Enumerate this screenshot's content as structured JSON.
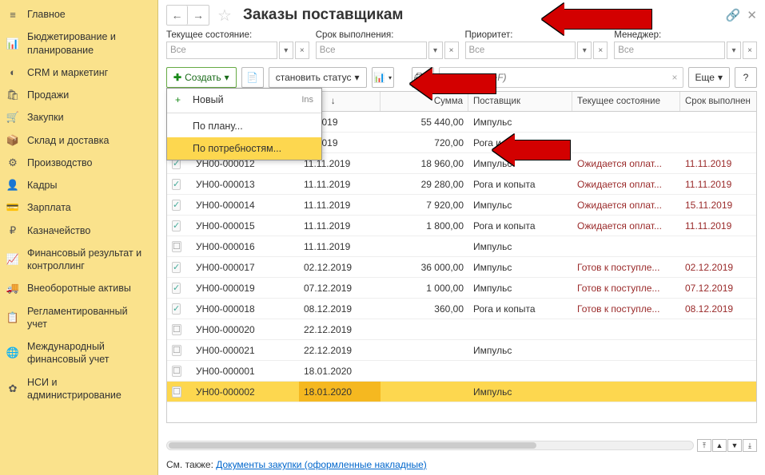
{
  "sidebar": {
    "items": [
      {
        "icon": "≡",
        "label": "Главное"
      },
      {
        "icon": "📊",
        "label": "Бюджетирование и планирование"
      },
      {
        "icon": "◐",
        "label": "CRM и маркетинг"
      },
      {
        "icon": "🛍",
        "label": "Продажи"
      },
      {
        "icon": "🛒",
        "label": "Закупки"
      },
      {
        "icon": "📦",
        "label": "Склад и доставка"
      },
      {
        "icon": "⚙",
        "label": "Производство"
      },
      {
        "icon": "👤",
        "label": "Кадры"
      },
      {
        "icon": "💳",
        "label": "Зарплата"
      },
      {
        "icon": "₽",
        "label": "Казначейство"
      },
      {
        "icon": "📈",
        "label": "Финансовый результат и контроллинг"
      },
      {
        "icon": "🚚",
        "label": "Внеоборотные активы"
      },
      {
        "icon": "📋",
        "label": "Регламентированный учет"
      },
      {
        "icon": "🌐",
        "label": "Международный финансовый учет"
      },
      {
        "icon": "✿",
        "label": "НСИ и администрирование"
      }
    ]
  },
  "header": {
    "title": "Заказы поставщикам"
  },
  "filters": {
    "f1": {
      "label": "Текущее состояние:",
      "value": "Все"
    },
    "f2": {
      "label": "Срок выполнения:",
      "value": "Все"
    },
    "f3": {
      "label": "Приоритет:",
      "value": "Все"
    },
    "f4": {
      "label": "Менеджер:",
      "value": "Все"
    }
  },
  "toolbar": {
    "create": "Создать",
    "set_status": "становить статус",
    "search_ph": "Поиск (Ctrl+F)",
    "more": "Еще",
    "help": "?"
  },
  "dropdown": {
    "items": [
      {
        "icon": "+",
        "label": "Новый",
        "shortcut": "Ins"
      },
      {
        "icon": "",
        "label": "По плану...",
        "shortcut": ""
      },
      {
        "icon": "",
        "label": "По потребностям...",
        "shortcut": "",
        "hl": true
      }
    ]
  },
  "table": {
    "headers": {
      "date": "та",
      "sum": "Сумма",
      "supplier": "Поставщик",
      "status": "Текущее состояние",
      "deadline": "Срок выполнен"
    },
    "rows": [
      {
        "icon": "✓",
        "no": "",
        "date": "11.2019",
        "sum": "55 440,00",
        "supplier": "Импульс",
        "status": "",
        "deadline": ""
      },
      {
        "icon": "✓",
        "no": "",
        "date": "11.2019",
        "sum": "720,00",
        "supplier": "Рога и копыта",
        "status": "",
        "deadline": ""
      },
      {
        "icon": "✓",
        "no": "УН00-000012",
        "date": "11.11.2019",
        "sum": "18 960,00",
        "supplier": "Импульс",
        "status": "Ожидается оплат...",
        "deadline": "11.11.2019"
      },
      {
        "icon": "✓",
        "no": "УН00-000013",
        "date": "11.11.2019",
        "sum": "29 280,00",
        "supplier": "Рога и копыта",
        "status": "Ожидается оплат...",
        "deadline": "11.11.2019"
      },
      {
        "icon": "✓",
        "no": "УН00-000014",
        "date": "11.11.2019",
        "sum": "7 920,00",
        "supplier": "Импульс",
        "status": "Ожидается оплат...",
        "deadline": "15.11.2019"
      },
      {
        "icon": "✓",
        "no": "УН00-000015",
        "date": "11.11.2019",
        "sum": "1 800,00",
        "supplier": "Рога и копыта",
        "status": "Ожидается оплат...",
        "deadline": "11.11.2019"
      },
      {
        "icon": "",
        "no": "УН00-000016",
        "date": "11.11.2019",
        "sum": "",
        "supplier": "Импульс",
        "status": "",
        "deadline": ""
      },
      {
        "icon": "✓",
        "no": "УН00-000017",
        "date": "02.12.2019",
        "sum": "36 000,00",
        "supplier": "Импульс",
        "status": "Готов к поступле...",
        "deadline": "02.12.2019"
      },
      {
        "icon": "✓",
        "no": "УН00-000019",
        "date": "07.12.2019",
        "sum": "1 000,00",
        "supplier": "Импульс",
        "status": "Готов к поступле...",
        "deadline": "07.12.2019"
      },
      {
        "icon": "✓",
        "no": "УН00-000018",
        "date": "08.12.2019",
        "sum": "360,00",
        "supplier": "Рога и копыта",
        "status": "Готов к поступле...",
        "deadline": "08.12.2019"
      },
      {
        "icon": "",
        "no": "УН00-000020",
        "date": "22.12.2019",
        "sum": "",
        "supplier": "",
        "status": "",
        "deadline": ""
      },
      {
        "icon": "",
        "no": "УН00-000021",
        "date": "22.12.2019",
        "sum": "",
        "supplier": "Импульс",
        "status": "",
        "deadline": ""
      },
      {
        "icon": "",
        "no": "УН00-000001",
        "date": "18.01.2020",
        "sum": "",
        "supplier": "",
        "status": "",
        "deadline": ""
      },
      {
        "icon": "",
        "no": "УН00-000002",
        "date": "18.01.2020",
        "sum": "",
        "supplier": "Импульс",
        "status": "",
        "deadline": "",
        "sel": true
      }
    ]
  },
  "footer": {
    "prefix": "См. также: ",
    "link": "Документы закупки (оформленные накладные)"
  }
}
